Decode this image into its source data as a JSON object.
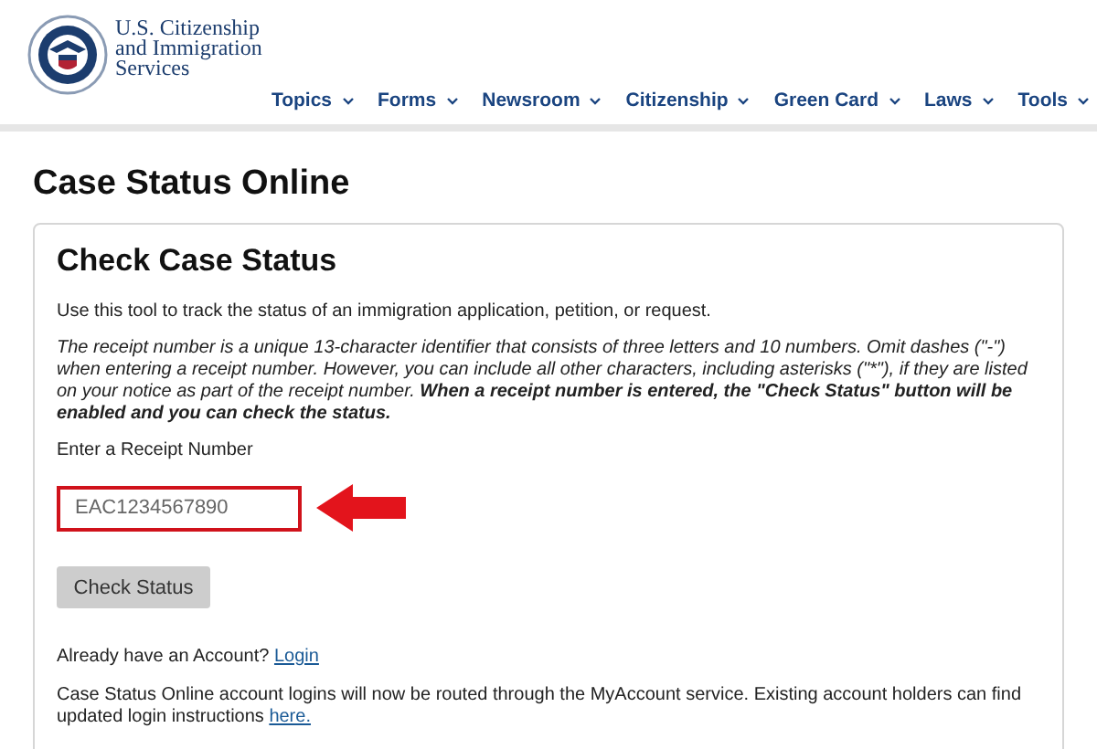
{
  "agency": {
    "name_lines": [
      "U.S. Citizenship",
      "and Immigration",
      "Services"
    ]
  },
  "nav": [
    {
      "label": "Topics"
    },
    {
      "label": "Forms"
    },
    {
      "label": "Newsroom"
    },
    {
      "label": "Citizenship"
    },
    {
      "label": "Green Card"
    },
    {
      "label": "Laws"
    },
    {
      "label": "Tools"
    }
  ],
  "page_title": "Case Status Online",
  "card": {
    "title": "Check Case Status",
    "intro": "Use this tool to track the status of an immigration application, petition, or request.",
    "note": "The receipt number is a unique 13-character identifier that consists of three letters and 10 numbers. Omit dashes (\"-\") when entering a receipt number. However, you can include all other characters, including asterisks (\"*\"), if they are listed on your notice as part of the receipt number. **When a receipt number is entered, the \"Check Status\" button will be enabled and you can check the status.**",
    "field_label": "Enter a Receipt Number",
    "field": {
      "placeholder": "EAC1234567890",
      "highlighted": true
    },
    "button": {
      "label": "Check Status",
      "disabled": true
    },
    "account_prompt": "Already have an Account?",
    "login_link": "Login",
    "notice": "Case Status Online account logins will now be routed through the MyAccount service. Existing account holders can find updated login instructions",
    "notice_link": "here."
  }
}
